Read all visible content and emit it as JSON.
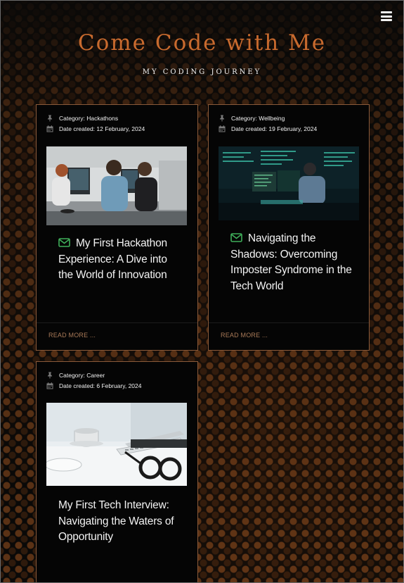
{
  "site": {
    "title": "Come Code with Me",
    "tagline": "MY CODING JOURNEY"
  },
  "icons": {
    "menu": "hamburger-icon",
    "category": "pushpin-icon",
    "date": "calendar-icon",
    "envelope": "envelope-icon"
  },
  "colors": {
    "accent": "#c86a2e",
    "envelope": "#3fae5a",
    "read_more": "#a97a58",
    "card_border": "#8a5a3a"
  },
  "posts": [
    {
      "category": "Category: Hackathons",
      "date": "Date created: 12 February, 2024",
      "title": "My First Hackathon Experience: A Dive into the World of Innovation",
      "read_more": "READ MORE ..."
    },
    {
      "category": "Category: Wellbeing",
      "date": "Date created: 19 February, 2024",
      "title": "Navigating the Shadows: Overcoming Imposter Syndrome in the Tech World",
      "read_more": "READ MORE ..."
    },
    {
      "category": "Category: Career",
      "date": "Date created: 6 February, 2024",
      "title": "My First Tech Interview: Navigating the Waters of Opportunity",
      "read_more": ""
    }
  ]
}
